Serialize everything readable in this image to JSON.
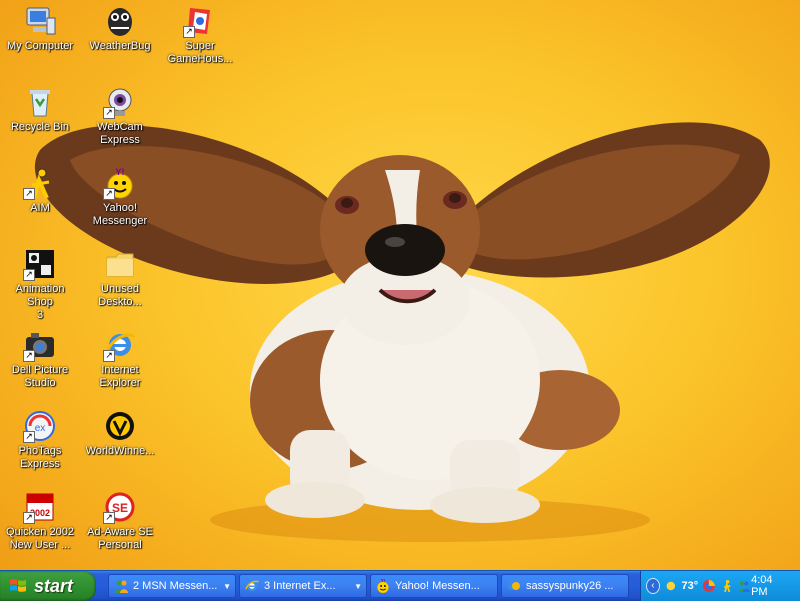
{
  "desktop": {
    "icons": [
      {
        "label": "My Computer",
        "icon": "my-computer-icon",
        "shortcut": false
      },
      {
        "label": "Recycle Bin",
        "icon": "recycle-bin-icon",
        "shortcut": false
      },
      {
        "label": "AIM",
        "icon": "aim-icon",
        "shortcut": true
      },
      {
        "label": "Animation Shop\n3",
        "icon": "animation-shop-icon",
        "shortcut": true
      },
      {
        "label": "Dell Picture\nStudio",
        "icon": "dell-picture-studio-icon",
        "shortcut": true
      },
      {
        "label": "PhoTags\nExpress",
        "icon": "photags-express-icon",
        "shortcut": true
      },
      {
        "label": "Quicken 2002\nNew User ...",
        "icon": "quicken-icon",
        "shortcut": true
      },
      {
        "label": "WeatherBug",
        "icon": "weatherbug-icon",
        "shortcut": false
      },
      {
        "label": "WebCam\nExpress",
        "icon": "webcam-express-icon",
        "shortcut": true
      },
      {
        "label": "Yahoo!\nMessenger",
        "icon": "yahoo-messenger-icon",
        "shortcut": true
      },
      {
        "label": "Unused\nDeskto...",
        "icon": "folder-icon",
        "shortcut": false
      },
      {
        "label": "Internet\nExplorer",
        "icon": "internet-explorer-icon",
        "shortcut": true
      },
      {
        "label": "WorldWinne...",
        "icon": "worldwinner-icon",
        "shortcut": false
      },
      {
        "label": "Ad-Aware SE\nPersonal",
        "icon": "ad-aware-icon",
        "shortcut": true
      },
      {
        "label": "Super\nGameHous...",
        "icon": "super-gamehouse-icon",
        "shortcut": true
      }
    ]
  },
  "taskbar": {
    "start_label": "start",
    "tasks": [
      {
        "label": "2 MSN Messen...",
        "icon": "msn-messenger-icon",
        "has_arrow": true
      },
      {
        "label": "3 Internet Ex...",
        "icon": "internet-explorer-icon",
        "has_arrow": true
      },
      {
        "label": "Yahoo! Messen...",
        "icon": "yahoo-messenger-icon",
        "has_arrow": false
      },
      {
        "label": "sassyspunky26 ...",
        "icon": "chat-icon",
        "has_arrow": false
      }
    ],
    "tray": {
      "temperature": "73°",
      "clock": "4:04 PM"
    }
  }
}
